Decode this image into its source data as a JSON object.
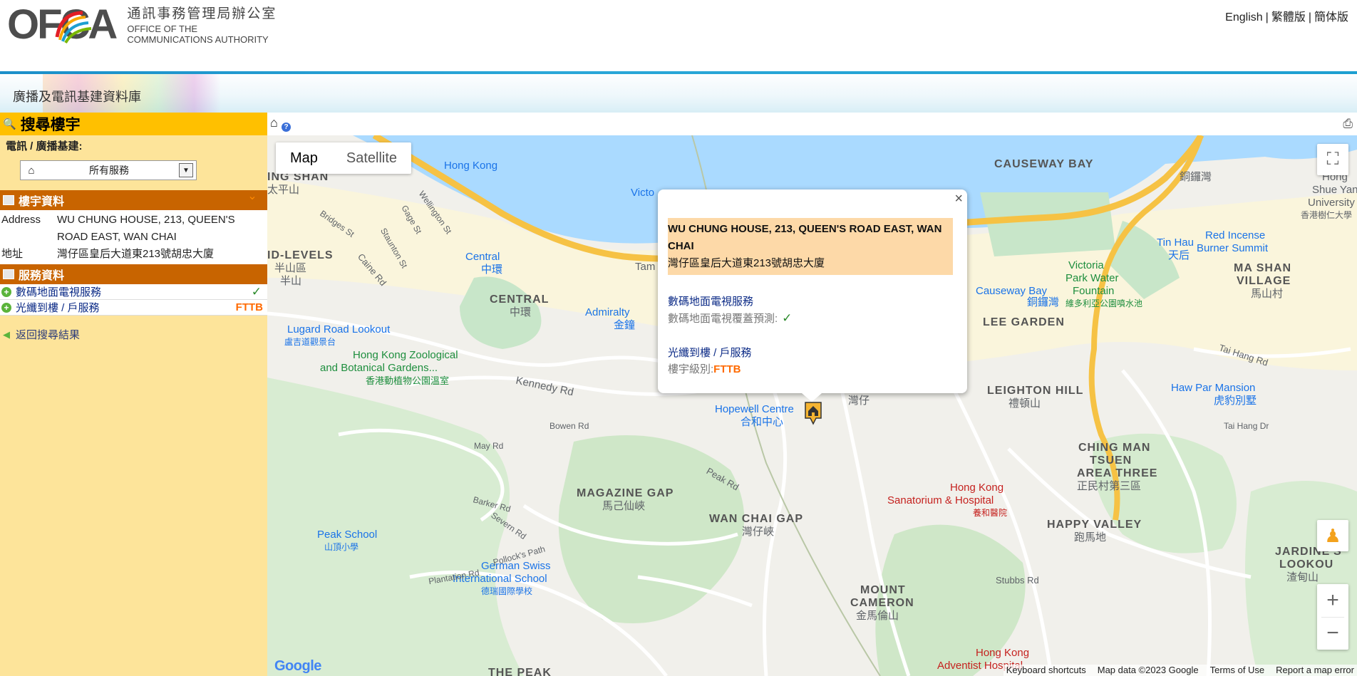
{
  "header": {
    "logo_word": "OFCA",
    "logo_cn": "通訊事務管理局辦公室",
    "logo_en_line1": "OFFICE OF THE",
    "logo_en_line2": "COMMUNICATIONS AUTHORITY",
    "languages": [
      "English",
      "繁體版",
      "簡体版"
    ]
  },
  "banner": {
    "title": "廣播及電訊基建資料庫"
  },
  "left_panel": {
    "search_title": "搜尋樓宇",
    "service_label": "電訊 / 廣播基建:",
    "service_select": "所有服務",
    "building_section": "樓宇資料",
    "address_label": "Address",
    "address_value": "WU CHUNG HOUSE, 213, QUEEN'S ROAD EAST, WAN CHAI",
    "address_zh_label": "地址",
    "address_zh_value": "灣仔區皇后大道東213號胡忠大廈",
    "service_section": "服務資料",
    "services": [
      {
        "name": "數碼地面電視服務",
        "status": "✓"
      },
      {
        "name": "光纖到樓 / 戶服務",
        "status": "FTTB"
      }
    ],
    "back_link": "返回搜尋結果"
  },
  "map": {
    "map_types": [
      "Map",
      "Satellite"
    ],
    "labels": {
      "causeway_bay": "CAUSEWAY BAY",
      "causeway_bay_zh": "銅鑼灣",
      "ming_shan": "ING SHAN",
      "ping_shan_zh": "太平山",
      "hong_kong": "Hong Kong",
      "victoria": "Victo",
      "mid_levels": "ID-LEVELS",
      "mid_levels_zh1": "半山區",
      "mid_levels_zh2": "半山",
      "central": "Central",
      "central_zh": "中環",
      "central_area": "CENTRAL",
      "central_area_zh": "中環",
      "admiralty": "Admiralty",
      "admiralty_zh": "金鐘",
      "tam": "Tam",
      "lugard": "Lugard Road Lookout",
      "lugard_zh": "盧吉道觀景台",
      "zoo1": "Hong Kong Zoological",
      "zoo2": "and Botanical Gardens...",
      "zoo_zh": "香港動植物公園溫室",
      "kennedy_rd": "Kennedy Rd",
      "bowen_rd": "Bowen Rd",
      "may_rd": "May Rd",
      "hopewell": "Hopewell Centre",
      "hopewell_zh": "合和中心",
      "wanchai_zh": "灣仔",
      "causeway_bay_stn": "Causeway Bay",
      "causeway_bay_stn_zh": "銅鑼灣",
      "victoria_park1": "Victoria",
      "victoria_park2": "Park Water",
      "victoria_park3": "Fountain",
      "victoria_park_zh": "維多利亞公園噴水池",
      "tin_hau": "Tin Hau",
      "tin_hau_zh": "天后",
      "red_incense1": "Red Incense",
      "red_incense2": "Burner Summit",
      "ma_shan1": "MA SHAN",
      "ma_shan2": "VILLAGE",
      "ma_shan_zh": "馬山村",
      "lee_garden": "LEE GARDEN",
      "leighton_hill": "LEIGHTON HILL",
      "leighton_hill_zh": "禮頓山",
      "tai_hang_rd": "Tai Hang Rd",
      "haw_par": "Haw Par Mansion",
      "haw_par_zh": "虎豹別墅",
      "tai_hang_dr": "Tai Hang Dr",
      "ching_man1": "CHING MAN",
      "ching_man2": "TSUEN",
      "ching_man3": "AREA THREE",
      "ching_man_zh": "正民村第三區",
      "magazine_gap": "MAGAZINE GAP",
      "magazine_gap_zh": "馬己仙峽",
      "wanchai_gap": "WAN CHAI GAP",
      "wanchai_gap_zh": "灣仔峽",
      "peak_rd": "Peak Rd",
      "sanatorium1": "Hong Kong",
      "sanatorium2": "Sanatorium & Hospital",
      "sanatorium_zh": "養和醫院",
      "happy_valley": "HAPPY VALLEY",
      "happy_valley_zh": "跑馬地",
      "jardine1": "JARDINE'S",
      "jardine2": "LOOKOU",
      "jardine_zh": "渣甸山",
      "peak_school": "Peak School",
      "peak_school_zh": "山頂小學",
      "german_swiss1": "German Swiss",
      "german_swiss2": "International School",
      "german_swiss_zh": "德瑞國際學校",
      "mount_cameron1": "MOUNT",
      "mount_cameron2": "CAMERON",
      "mount_cameron_zh": "金馬倫山",
      "stubbs_rd": "Stubbs Rd",
      "adventist1": "Hong Kong",
      "adventist2": "Adventist Hospital",
      "the_peak": "THE PEAK",
      "hk_univ1": "Hong",
      "hk_univ2": "Shue Yan",
      "hk_univ3": "University",
      "hk_univ_zh": "香港樹仁大學",
      "caine_rd": "Caine Rd",
      "wellington": "Wellington St",
      "gage": "Gage St",
      "bridges": "Bridges St",
      "staunton": "Staunton St",
      "barker": "Barker Rd",
      "severn": "Severn Rd",
      "pollock": "Pollock's Path",
      "plantation": "Plantation Rd"
    },
    "attribution": [
      "Keyboard shortcuts",
      "Map data ©2023 Google",
      "Terms of Use",
      "Report a map error"
    ],
    "google": "Google",
    "infowindow": {
      "title_en": "WU CHUNG HOUSE, 213, QUEEN'S ROAD EAST, WAN CHAI",
      "title_zh": "灣仔區皇后大道東213號胡忠大廈",
      "service1_name": "數碼地面電視服務",
      "service1_sub": "數碼地面電視覆蓋預測:",
      "service1_value": "✓",
      "service2_name": "光纖到樓 / 戶服務",
      "service2_sub": "樓宇級別:",
      "service2_value": "FTTB"
    }
  },
  "colors": {
    "accent_orange": "#c86400",
    "search_yellow": "#ffc000",
    "panel_bg": "#fde49a",
    "water": "#aadaff",
    "park": "#c8e6c9",
    "highway": "#f6c244"
  }
}
